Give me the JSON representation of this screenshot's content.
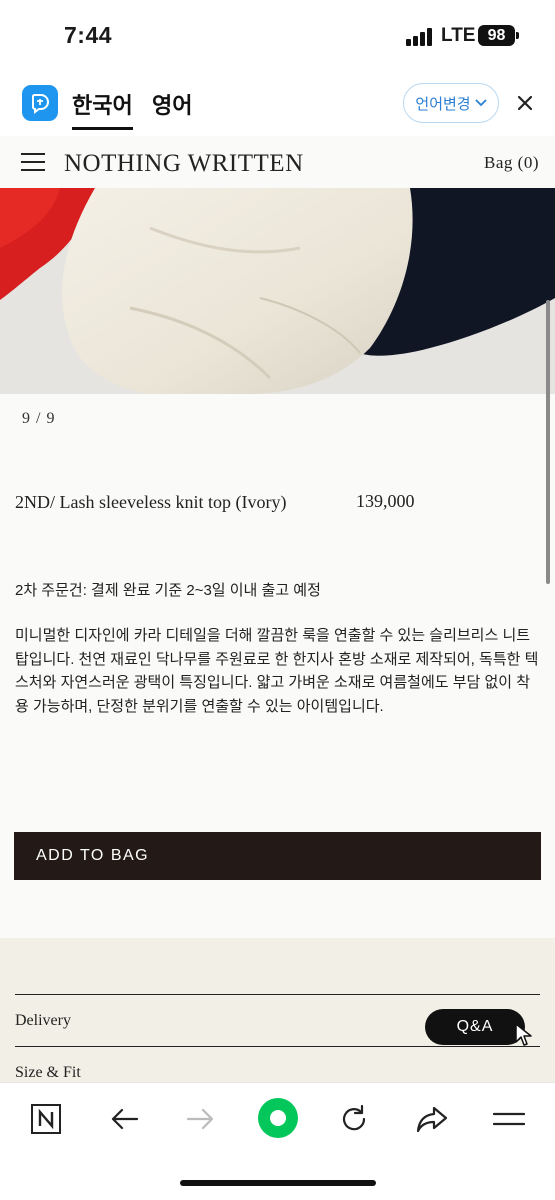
{
  "status_bar": {
    "time": "7:44",
    "network": "LTE",
    "battery": "98"
  },
  "translator": {
    "active_language": "한국어",
    "other_language": "영어",
    "change_language_label": "언어변경",
    "accent_color": "#1e96f0"
  },
  "site": {
    "logo": "NOTHING WRITTEN",
    "bag_label": "Bag (0)"
  },
  "product": {
    "image_counter": "9 / 9",
    "name": "2ND/ Lash sleeveless knit top (Ivory)",
    "price": "139,000",
    "shipping_note": "2차 주문건: 결제 완료 기준 2~3일 이내 출고 예정",
    "description": "미니멀한 디자인에 카라 디테일을 더해 깔끔한 룩을 연출할 수 있는 슬리브리스 니트 탑입니다. 천연 재료인 닥나무를 주원료로 한 한지사 혼방 소재로 제작되어, 독특한 텍스처와 자연스러운 광택이 특징입니다. 얇고 가벼운 소재로 여름철에도 부담 없이 착용 가능하며, 단정한 분위기를 연출할 수 있는 아이템입니다.",
    "add_to_bag_label": "ADD TO BAG",
    "info_sections": [
      "Delivery",
      "Size & Fit"
    ],
    "qa_label": "Q&A"
  },
  "browser_toolbar": {
    "items": [
      "n-tab-icon",
      "back-arrow-icon",
      "forward-arrow-icon",
      "home-circle-icon",
      "reload-icon",
      "share-icon",
      "menu-icon"
    ],
    "accent_color": "#03c75a"
  }
}
